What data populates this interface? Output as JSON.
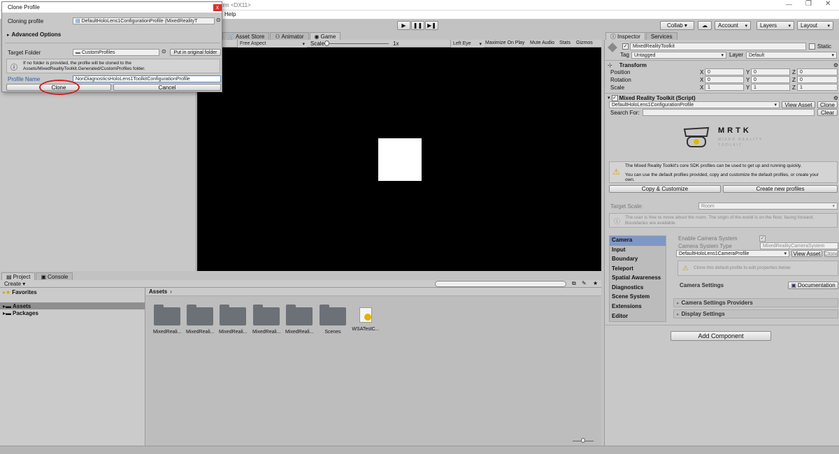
{
  "window": {
    "title_suffix": "orm <DX11>",
    "menu_help": "Help"
  },
  "toolbar": {
    "collab": "Collab ▾",
    "account": "Account",
    "layers": "Layers",
    "layout": "Layout"
  },
  "center_tabs": {
    "asset_store": "Asset Store",
    "animator": "Animator",
    "game": "Game"
  },
  "game_bar": {
    "aspect": "Free Aspect",
    "scale": "Scale",
    "scale_value": "1x",
    "left_eye": "Left Eye",
    "maximize": "Maximize On Play",
    "mute": "Mute Audio",
    "stats": "Stats",
    "gizmos": "Gizmos"
  },
  "dialog": {
    "title": "Clone Profile",
    "close": "x",
    "cloning_label": "Cloning profile",
    "cloning_value": "DefaultHoloLens1ConfigurationProfile (MixedRealityT",
    "advanced": "Advanced Options",
    "target_label": "Target Folder",
    "target_value": "CustomProfiles",
    "put_original": "Put in original folder",
    "info_line1": "If no folder is provided, the profile will be cloned to the",
    "info_line2": "Assets/MixedRealityToolkit.Generated/CustomProfiles folder.",
    "name_label": "Profile Name",
    "name_value": "NonDiagnosticsHoloLens1ToolkitConfigurationProfile",
    "clone": "Clone",
    "cancel": "Cancel"
  },
  "project": {
    "tab_project": "Project",
    "tab_console": "Console",
    "create": "Create ▾",
    "favorites": "Favorites",
    "assets_tree": "Assets",
    "packages": "Packages",
    "breadcrumb": "Assets",
    "breadcrumb_arrow": "›",
    "items": [
      "MixedReali...",
      "MixedReali...",
      "MixedReali...",
      "MixedReali...",
      "MixedReali...",
      "Scenes",
      "WSATestC..."
    ]
  },
  "inspector": {
    "tab_inspector": "Inspector",
    "tab_services": "Services",
    "object_name": "MixedRealityToolkit",
    "static": "Static",
    "tag_label": "Tag",
    "tag_value": "Untagged",
    "layer_label": "Layer",
    "layer_value": "Default",
    "transform": "Transform",
    "position": "Position",
    "rotation": "Rotation",
    "scale": "Scale",
    "x": "X",
    "y": "Y",
    "z": "Z",
    "pos": [
      "0",
      "0",
      "0"
    ],
    "rot": [
      "0",
      "0",
      "0"
    ],
    "scl": [
      "1",
      "1",
      "1"
    ],
    "script_title": "Mixed Reality Toolkit (Script)",
    "profile_value": "DefaultHoloLens1ConfigurationProfile",
    "view_asset": "View Asset",
    "clone": "Clone",
    "search_label": "Search For:",
    "clear": "Clear",
    "logo_title": "MRTK",
    "logo_sub1": "MIXED REALITY",
    "logo_sub2": "TOOLKIT",
    "warn_line1": "The Mixed Reality Toolkit's core SDK profiles can be used to get up and running quickly.",
    "warn_line2": "You can use the default profiles provided, copy and customize the default profiles, or create your",
    "warn_line3": "own.",
    "copy_customize": "Copy & Customize",
    "create_new": "Create new profiles",
    "target_scale_label": "Target Scale:",
    "target_scale_value": "Room",
    "room_info1": "The user is free to move about the room. The origin of the world is on the floor, facing forward.",
    "room_info2": "Boundaries are available.",
    "categories": [
      "Camera",
      "Input",
      "Boundary",
      "Teleport",
      "Spatial Awareness",
      "Diagnostics",
      "Scene System",
      "Extensions",
      "Editor"
    ],
    "enable_camera": "Enable Camera System",
    "camera_type_label": "Camera System Type",
    "camera_type_value": "MixedRealityCameraSystem",
    "camera_profile": "DefaultHoloLens1CameraProfile",
    "view_asset2": "View Asset",
    "clone2": "Clone",
    "clone_hint": "Clone this default profile to edit properties below",
    "camera_settings": "Camera Settings",
    "documentation": "Documentation",
    "providers": "Camera Settings Providers",
    "display": "Display Settings",
    "add_component": "Add Component"
  }
}
